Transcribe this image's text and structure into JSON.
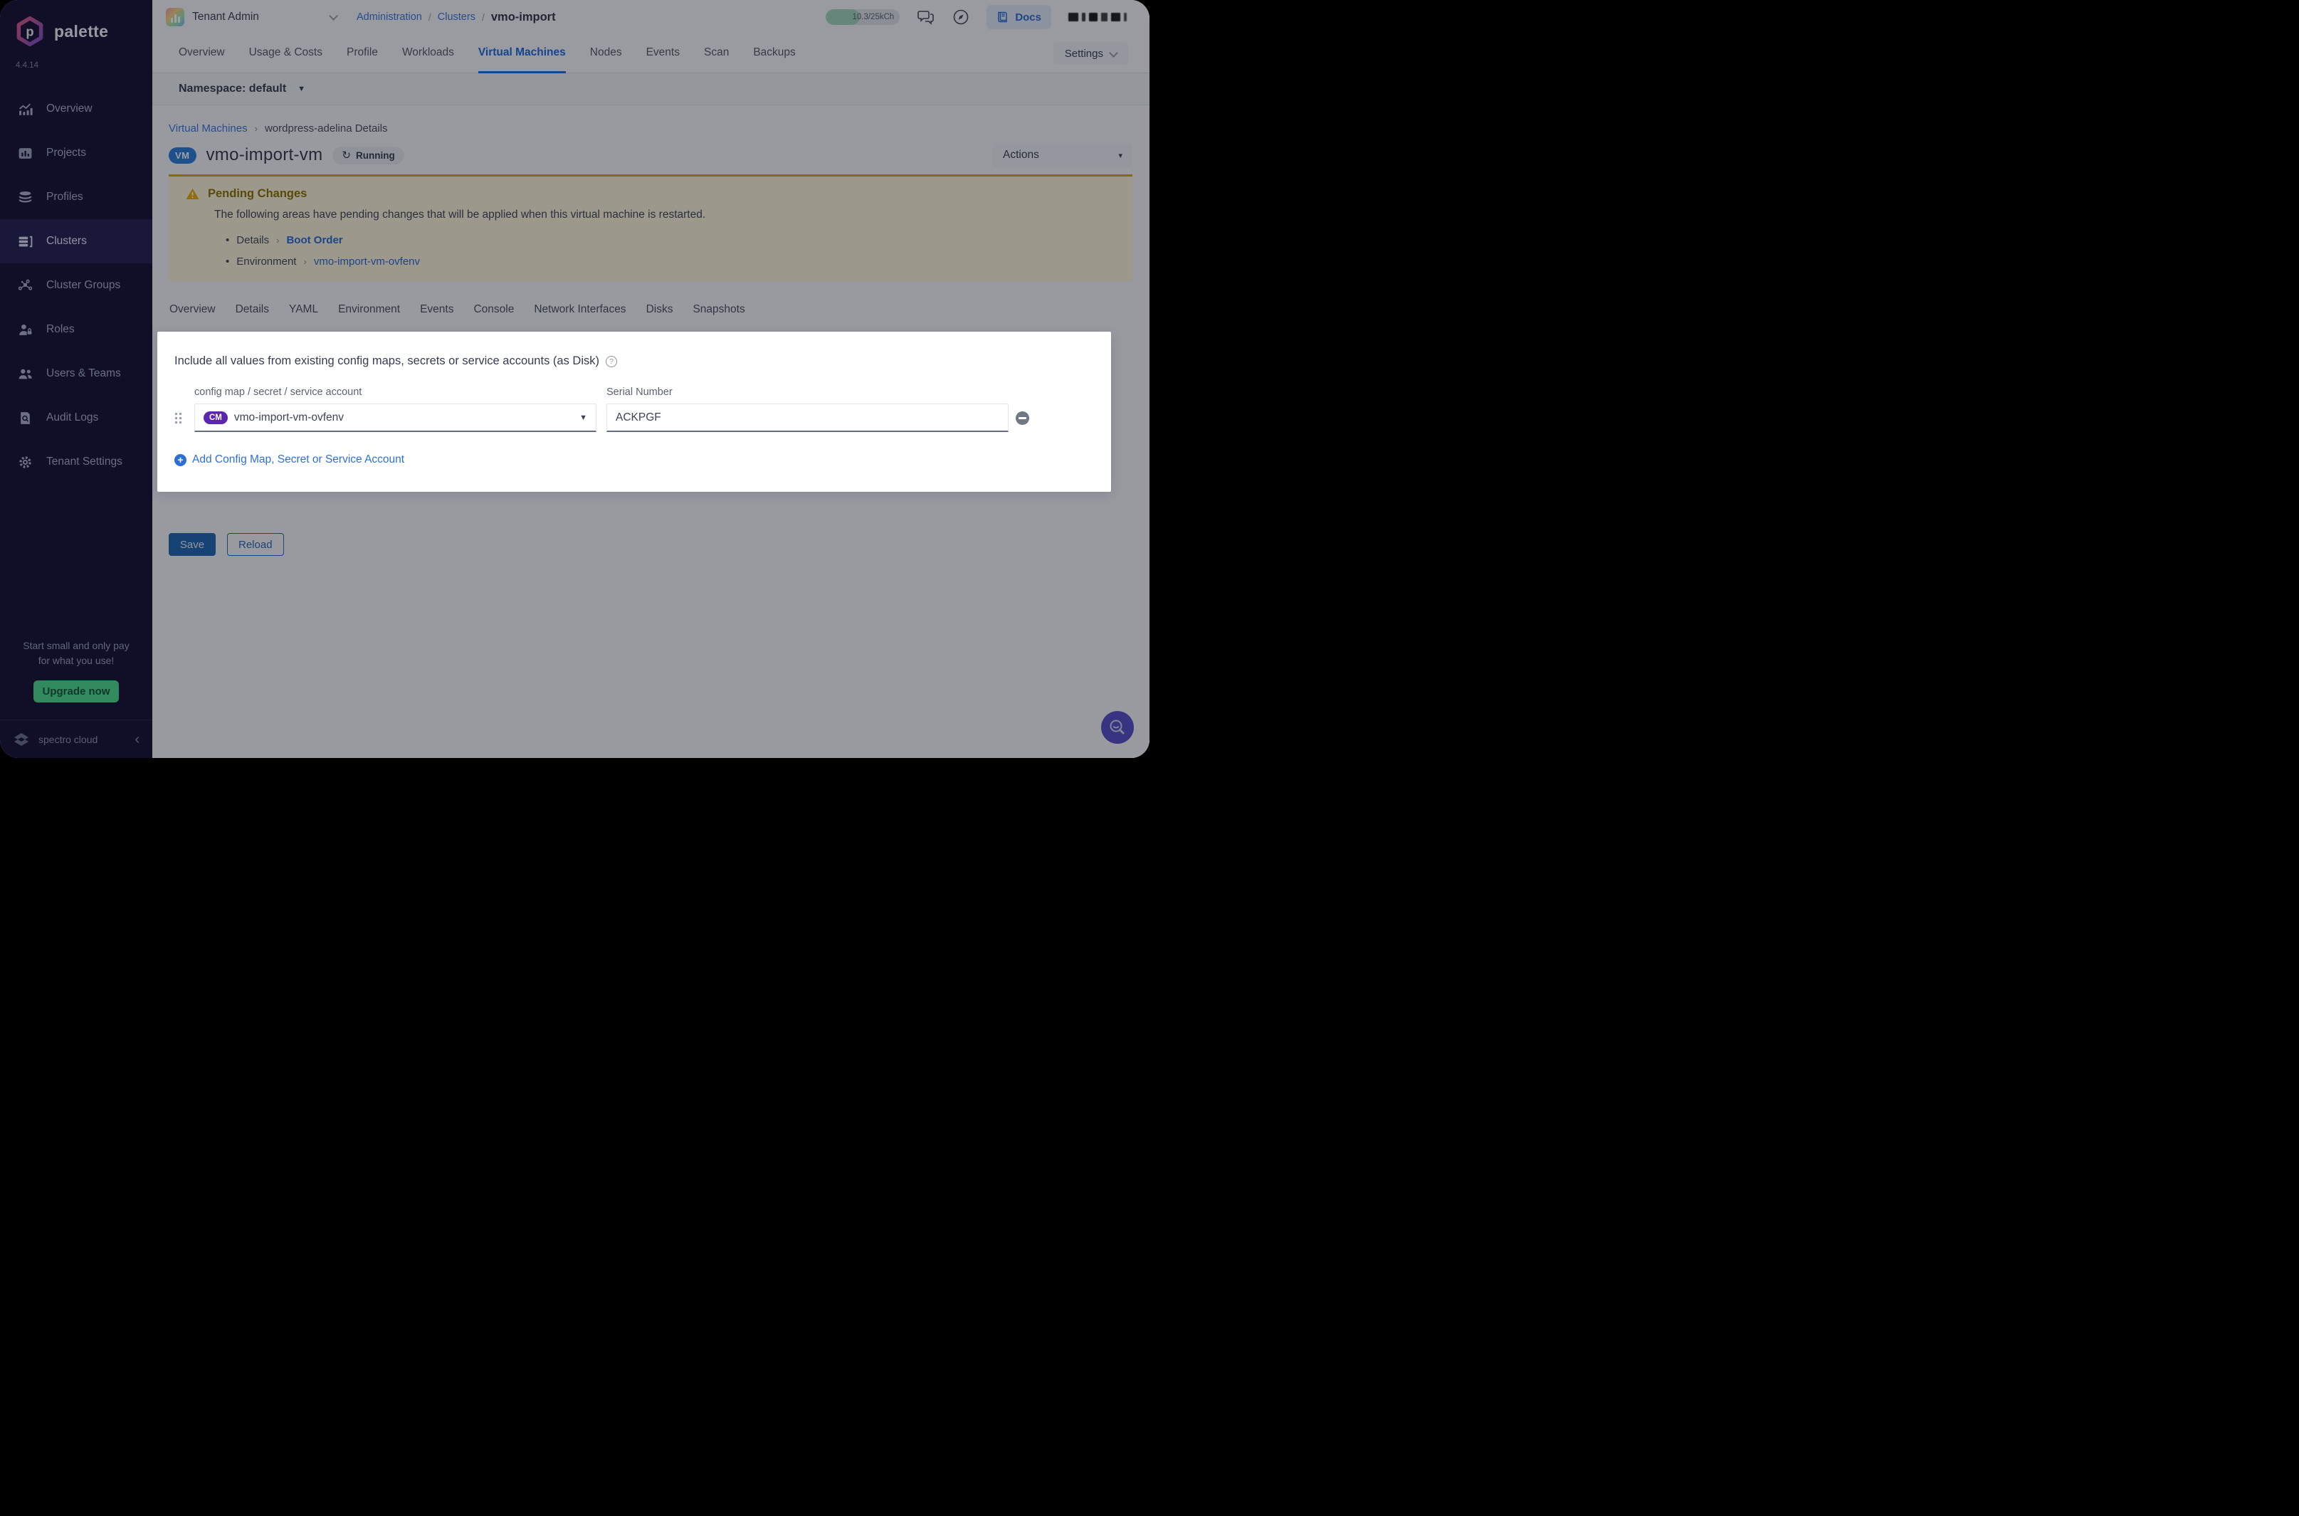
{
  "app": {
    "brand": "palette",
    "version": "4.4.14",
    "footer_brand": "spectro cloud"
  },
  "glyphs": {
    "caret_down": "▾",
    "caret_down_small": "▼",
    "refresh": "↻",
    "breadcrumb_sep": "/",
    "chevron_sep": "›",
    "collapse": "‹",
    "help": "?",
    "plus": "+",
    "bullet": "•",
    "warning_mark": "!"
  },
  "topbar": {
    "tenant": "Tenant Admin",
    "breadcrumb": [
      "Administration",
      "Clusters",
      "vmo-import"
    ],
    "usage": "10.3/25kCh",
    "docs": "Docs"
  },
  "cluster_tabs": {
    "items": [
      "Overview",
      "Usage & Costs",
      "Profile",
      "Workloads",
      "Virtual Machines",
      "Nodes",
      "Events",
      "Scan",
      "Backups"
    ],
    "active": "Virtual Machines",
    "settings": "Settings"
  },
  "namespace_bar": {
    "label": "Namespace: default"
  },
  "vm_header": {
    "breadcrumb_link": "Virtual Machines",
    "breadcrumb_current": "wordpress-adelina Details",
    "badge": "VM",
    "title": "vmo-import-vm",
    "status": "Running",
    "actions": "Actions"
  },
  "pending": {
    "title": "Pending Changes",
    "description": "The following areas have pending changes that will be applied when this virtual machine is restarted.",
    "items": [
      {
        "area": "Details",
        "link": "Boot Order"
      },
      {
        "area": "Environment",
        "link": "vmo-import-vm-ovfenv"
      }
    ]
  },
  "vm_tabs": {
    "items": [
      "Overview",
      "Details",
      "YAML",
      "Environment",
      "Events",
      "Console",
      "Network Interfaces",
      "Disks",
      "Snapshots"
    ],
    "active": "Environment"
  },
  "environment_card": {
    "title": "Include all values from existing config maps, secrets or service accounts (as Disk)",
    "col1_label": "config map / secret / service account",
    "col2_label": "Serial Number",
    "row": {
      "badge": "CM",
      "name": "vmo-import-vm-ovfenv",
      "serial": "ACKPGF"
    },
    "add_label": "Add Config Map, Secret or Service Account"
  },
  "form_actions": {
    "save": "Save",
    "reload": "Reload"
  },
  "sidebar": {
    "items": [
      {
        "label": "Overview",
        "icon": "overview-icon"
      },
      {
        "label": "Projects",
        "icon": "projects-icon"
      },
      {
        "label": "Profiles",
        "icon": "profiles-icon"
      },
      {
        "label": "Clusters",
        "icon": "clusters-icon"
      },
      {
        "label": "Cluster Groups",
        "icon": "cluster-groups-icon"
      },
      {
        "label": "Roles",
        "icon": "roles-icon"
      },
      {
        "label": "Users & Teams",
        "icon": "users-teams-icon"
      },
      {
        "label": "Audit Logs",
        "icon": "audit-logs-icon"
      },
      {
        "label": "Tenant Settings",
        "icon": "tenant-settings-icon"
      }
    ],
    "active": "Clusters",
    "promo": {
      "line1": "Start small and only pay",
      "line2": "for what you use!",
      "cta": "Upgrade now"
    }
  },
  "colors": {
    "accent_blue": "#1e6ce0",
    "link_blue": "#2d6fd9",
    "warning_border": "#d5a713",
    "warning_bg": "#fbf2d9",
    "success_green": "#50dd92",
    "badge_purple": "#5c27ae",
    "vm_badge_blue": "#2f80d9",
    "sidebar_bg": "#191638",
    "save_blue": "#2368b4",
    "support_fab": "#5b51c8"
  }
}
